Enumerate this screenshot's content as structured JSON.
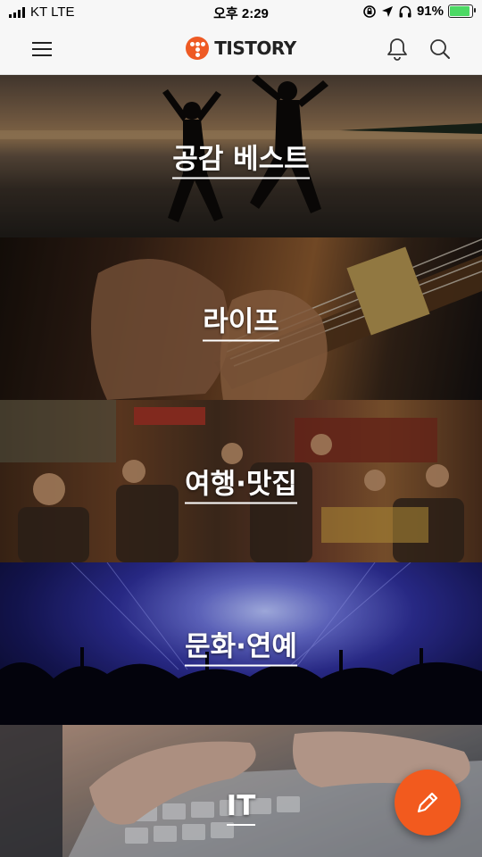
{
  "status_bar": {
    "carrier": "KT LTE",
    "time": "오후 2:29",
    "battery": "91%",
    "battery_level": 0.91,
    "icons": [
      "signal-icon",
      "lock-rotation-icon",
      "location-icon",
      "headphones-icon",
      "battery-icon"
    ]
  },
  "header": {
    "logo_text": "TISTORY",
    "icons": [
      "menu-icon",
      "bell-icon",
      "search-icon"
    ],
    "brand_color": "#f25a1e"
  },
  "categories": [
    {
      "label": "공감 베스트"
    },
    {
      "label": "라이프"
    },
    {
      "label": "여행·맛집"
    },
    {
      "label": "문화·연예"
    },
    {
      "label": "IT"
    }
  ],
  "fab": {
    "icon": "pencil-icon",
    "color": "#f25a1e"
  }
}
